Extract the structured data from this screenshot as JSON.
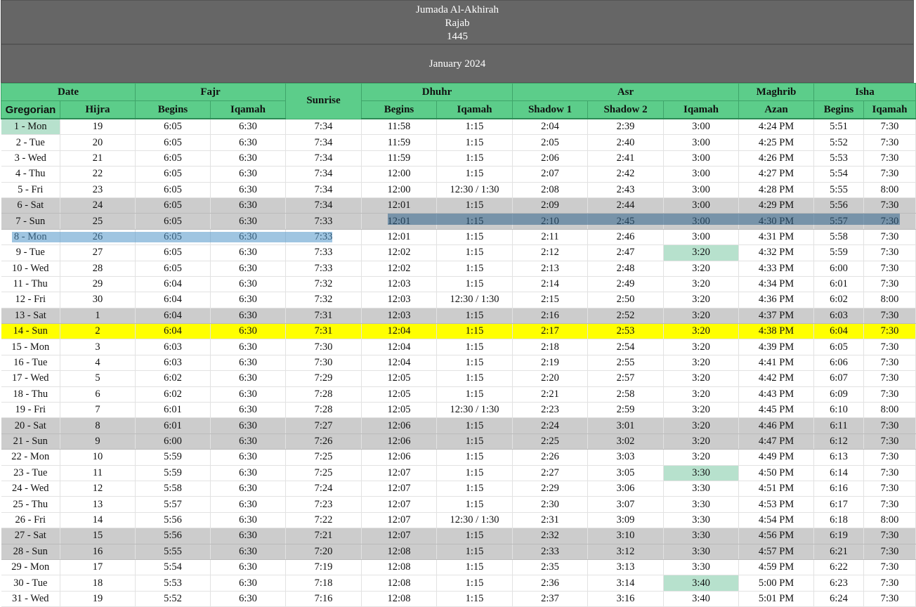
{
  "header": {
    "hijri_month_1": "Jumada Al-Akhirah",
    "hijri_month_2": "Rajab",
    "hijri_year": "1445",
    "gregorian_month": "January 2024"
  },
  "groups": {
    "date": "Date",
    "fajr": "Fajr",
    "sunrise": "Sunrise",
    "dhuhr": "Dhuhr",
    "asr": "Asr",
    "maghrib": "Maghrib",
    "isha": "Isha"
  },
  "subheaders": {
    "gregorian": "Gregorian",
    "hijra": "Hijra",
    "fajr_begins": "Begins",
    "fajr_iqamah": "Iqamah",
    "dhuhr_begins": "Begins",
    "dhuhr_iqamah": "Iqamah",
    "shadow1": "Shadow 1",
    "shadow2": "Shadow 2",
    "asr_iqamah": "Iqamah",
    "maghrib_azan": "Azan",
    "isha_begins": "Begins",
    "isha_iqamah": "Iqamah"
  },
  "colors": {
    "header_gray": "#666666",
    "header_green": "#5ccd8a",
    "weekend_gray": "#cccccc",
    "today_yellow": "#ffff00",
    "change_mint": "#b7e1cd"
  },
  "rows": [
    [
      "1 - Mon",
      "19",
      "6:05",
      "6:30",
      "7:34",
      "11:58",
      "1:15",
      "2:04",
      "2:39",
      "3:00",
      "4:24 PM",
      "5:51",
      "7:30"
    ],
    [
      "2 - Tue",
      "20",
      "6:05",
      "6:30",
      "7:34",
      "11:59",
      "1:15",
      "2:05",
      "2:40",
      "3:00",
      "4:25 PM",
      "5:52",
      "7:30"
    ],
    [
      "3 - Wed",
      "21",
      "6:05",
      "6:30",
      "7:34",
      "11:59",
      "1:15",
      "2:06",
      "2:41",
      "3:00",
      "4:26 PM",
      "5:53",
      "7:30"
    ],
    [
      "4 - Thu",
      "22",
      "6:05",
      "6:30",
      "7:34",
      "12:00",
      "1:15",
      "2:07",
      "2:42",
      "3:00",
      "4:27 PM",
      "5:54",
      "7:30"
    ],
    [
      "5 - Fri",
      "23",
      "6:05",
      "6:30",
      "7:34",
      "12:00",
      "12:30 / 1:30",
      "2:08",
      "2:43",
      "3:00",
      "4:28 PM",
      "5:55",
      "8:00"
    ],
    [
      "6 - Sat",
      "24",
      "6:05",
      "6:30",
      "7:34",
      "12:01",
      "1:15",
      "2:09",
      "2:44",
      "3:00",
      "4:29 PM",
      "5:56",
      "7:30"
    ],
    [
      "7 - Sun",
      "25",
      "6:05",
      "6:30",
      "7:33",
      "12:01",
      "1:15",
      "2:10",
      "2:45",
      "3:00",
      "4:30 PM",
      "5:57",
      "7:30"
    ],
    [
      "8 - Mon",
      "26",
      "6:05",
      "6:30",
      "7:33",
      "12:01",
      "1:15",
      "2:11",
      "2:46",
      "3:00",
      "4:31 PM",
      "5:58",
      "7:30"
    ],
    [
      "9 - Tue",
      "27",
      "6:05",
      "6:30",
      "7:33",
      "12:02",
      "1:15",
      "2:12",
      "2:47",
      "3:20",
      "4:32 PM",
      "5:59",
      "7:30"
    ],
    [
      "10 - Wed",
      "28",
      "6:05",
      "6:30",
      "7:33",
      "12:02",
      "1:15",
      "2:13",
      "2:48",
      "3:20",
      "4:33 PM",
      "6:00",
      "7:30"
    ],
    [
      "11 - Thu",
      "29",
      "6:04",
      "6:30",
      "7:32",
      "12:03",
      "1:15",
      "2:14",
      "2:49",
      "3:20",
      "4:34 PM",
      "6:01",
      "7:30"
    ],
    [
      "12 - Fri",
      "30",
      "6:04",
      "6:30",
      "7:32",
      "12:03",
      "12:30 / 1:30",
      "2:15",
      "2:50",
      "3:20",
      "4:36 PM",
      "6:02",
      "8:00"
    ],
    [
      "13 - Sat",
      "1",
      "6:04",
      "6:30",
      "7:31",
      "12:03",
      "1:15",
      "2:16",
      "2:52",
      "3:20",
      "4:37 PM",
      "6:03",
      "7:30"
    ],
    [
      "14 - Sun",
      "2",
      "6:04",
      "6:30",
      "7:31",
      "12:04",
      "1:15",
      "2:17",
      "2:53",
      "3:20",
      "4:38 PM",
      "6:04",
      "7:30"
    ],
    [
      "15 - Mon",
      "3",
      "6:03",
      "6:30",
      "7:30",
      "12:04",
      "1:15",
      "2:18",
      "2:54",
      "3:20",
      "4:39 PM",
      "6:05",
      "7:30"
    ],
    [
      "16 - Tue",
      "4",
      "6:03",
      "6:30",
      "7:30",
      "12:04",
      "1:15",
      "2:19",
      "2:55",
      "3:20",
      "4:41 PM",
      "6:06",
      "7:30"
    ],
    [
      "17 - Wed",
      "5",
      "6:02",
      "6:30",
      "7:29",
      "12:05",
      "1:15",
      "2:20",
      "2:57",
      "3:20",
      "4:42 PM",
      "6:07",
      "7:30"
    ],
    [
      "18 - Thu",
      "6",
      "6:02",
      "6:30",
      "7:28",
      "12:05",
      "1:15",
      "2:21",
      "2:58",
      "3:20",
      "4:43 PM",
      "6:09",
      "7:30"
    ],
    [
      "19 - Fri",
      "7",
      "6:01",
      "6:30",
      "7:28",
      "12:05",
      "12:30 / 1:30",
      "2:23",
      "2:59",
      "3:20",
      "4:45 PM",
      "6:10",
      "8:00"
    ],
    [
      "20 - Sat",
      "8",
      "6:01",
      "6:30",
      "7:27",
      "12:06",
      "1:15",
      "2:24",
      "3:01",
      "3:20",
      "4:46 PM",
      "6:11",
      "7:30"
    ],
    [
      "21 - Sun",
      "9",
      "6:00",
      "6:30",
      "7:26",
      "12:06",
      "1:15",
      "2:25",
      "3:02",
      "3:20",
      "4:47 PM",
      "6:12",
      "7:30"
    ],
    [
      "22 - Mon",
      "10",
      "5:59",
      "6:30",
      "7:25",
      "12:06",
      "1:15",
      "2:26",
      "3:03",
      "3:20",
      "4:49 PM",
      "6:13",
      "7:30"
    ],
    [
      "23 - Tue",
      "11",
      "5:59",
      "6:30",
      "7:25",
      "12:07",
      "1:15",
      "2:27",
      "3:05",
      "3:30",
      "4:50 PM",
      "6:14",
      "7:30"
    ],
    [
      "24 - Wed",
      "12",
      "5:58",
      "6:30",
      "7:24",
      "12:07",
      "1:15",
      "2:29",
      "3:06",
      "3:30",
      "4:51 PM",
      "6:16",
      "7:30"
    ],
    [
      "25 - Thu",
      "13",
      "5:57",
      "6:30",
      "7:23",
      "12:07",
      "1:15",
      "2:30",
      "3:07",
      "3:30",
      "4:53 PM",
      "6:17",
      "7:30"
    ],
    [
      "26 - Fri",
      "14",
      "5:56",
      "6:30",
      "7:22",
      "12:07",
      "12:30 / 1:30",
      "2:31",
      "3:09",
      "3:30",
      "4:54 PM",
      "6:18",
      "8:00"
    ],
    [
      "27 - Sat",
      "15",
      "5:56",
      "6:30",
      "7:21",
      "12:07",
      "1:15",
      "2:32",
      "3:10",
      "3:30",
      "4:56 PM",
      "6:19",
      "7:30"
    ],
    [
      "28 - Sun",
      "16",
      "5:55",
      "6:30",
      "7:20",
      "12:08",
      "1:15",
      "2:33",
      "3:12",
      "3:30",
      "4:57 PM",
      "6:21",
      "7:30"
    ],
    [
      "29 - Mon",
      "17",
      "5:54",
      "6:30",
      "7:19",
      "12:08",
      "1:15",
      "2:35",
      "3:13",
      "3:30",
      "4:59 PM",
      "6:22",
      "7:30"
    ],
    [
      "30 - Tue",
      "18",
      "5:53",
      "6:30",
      "7:18",
      "12:08",
      "1:15",
      "2:36",
      "3:14",
      "3:40",
      "5:00 PM",
      "6:23",
      "7:30"
    ],
    [
      "31 - Wed",
      "19",
      "5:52",
      "6:30",
      "7:16",
      "12:08",
      "1:15",
      "2:37",
      "3:16",
      "3:40",
      "5:01 PM",
      "6:24",
      "7:30"
    ]
  ],
  "weekend_rows": [
    5,
    6,
    12,
    19,
    20,
    26,
    27
  ],
  "today_row": 13,
  "mint_cells": [
    [
      0,
      0
    ],
    [
      8,
      9
    ],
    [
      22,
      9
    ],
    [
      29,
      9
    ]
  ]
}
